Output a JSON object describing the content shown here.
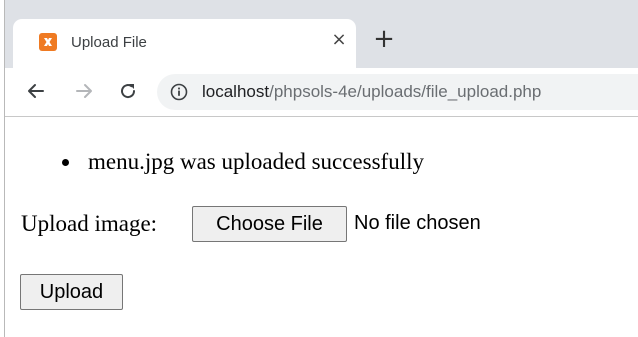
{
  "browser": {
    "tab": {
      "title": "Upload File",
      "favicon": "xampp-icon",
      "favicon_color": "#ef7a22",
      "close_label": "×"
    },
    "new_tab_label": "+",
    "address": {
      "host": "localhost",
      "path": "/phpsols-4e/uploads/file_upload.php"
    }
  },
  "page": {
    "messages": [
      "menu.jpg was uploaded successfully"
    ],
    "upload_label": "Upload image:",
    "choose_file_label": "Choose File",
    "no_file_text": "No file chosen",
    "upload_button_label": "Upload"
  }
}
